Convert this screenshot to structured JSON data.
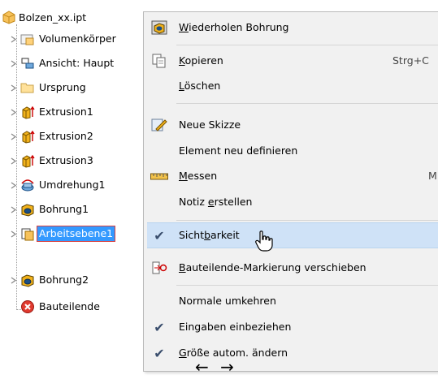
{
  "tree": {
    "root_label": "Bolzen_xx.ipt",
    "items": [
      {
        "label": "Volumenkörper",
        "icon": "solid-bodies-folder-icon"
      },
      {
        "label": "Ansicht: Haupt",
        "icon": "view-representation-icon"
      },
      {
        "label": "Ursprung",
        "icon": "origin-folder-icon"
      },
      {
        "label": "Extrusion1",
        "icon": "extrusion-icon"
      },
      {
        "label": "Extrusion2",
        "icon": "extrusion-icon"
      },
      {
        "label": "Extrusion3",
        "icon": "extrusion-icon"
      },
      {
        "label": "Umdrehung1",
        "icon": "revolve-icon"
      },
      {
        "label": "Bohrung1",
        "icon": "hole-icon"
      },
      {
        "label": "Arbeitsebene1",
        "icon": "work-plane-icon"
      },
      {
        "label": "Bohrung2",
        "icon": "hole-icon"
      },
      {
        "label": "Bauteilende",
        "icon": "end-of-part-icon"
      }
    ]
  },
  "menu": {
    "repeat_pre": "W",
    "repeat_rest": "iederholen Bohrung",
    "copy_pre": "K",
    "copy_rest": "opieren",
    "copy_shortcut": "Strg+C",
    "delete_pre": "L",
    "delete_rest": "öschen",
    "new_sketch": "Neue Skizze",
    "redefine": "Element neu definieren",
    "measure_pre": "M",
    "measure_rest": "essen",
    "measure_shortcut": "M",
    "note_a": "Notiz ",
    "note_u": "e",
    "note_b": "rstellen",
    "vis_a": "Sicht",
    "vis_u": "b",
    "vis_b": "arkeit",
    "eop_pre": "B",
    "eop_rest": "auteilende-Markierung verschieben",
    "flip_normal": "Normale umkehren",
    "include_inputs": "Eingaben einbeziehen",
    "autoresize_a": "G",
    "autoresize_b": "röße autom. ändern"
  },
  "footer": {
    "arrows": "← →"
  }
}
